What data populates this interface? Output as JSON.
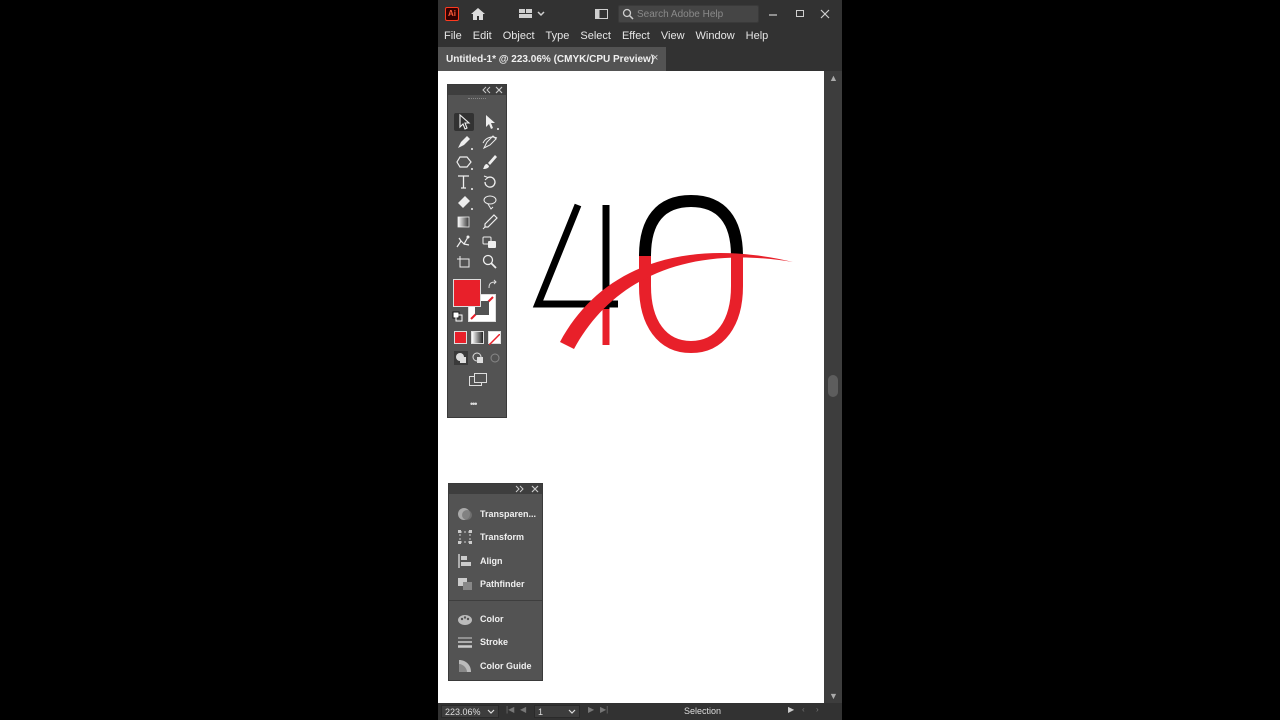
{
  "titlebar": {
    "app_badge": "Ai",
    "search_placeholder": "Search Adobe Help",
    "window_controls": [
      "minimize",
      "maximize",
      "close"
    ]
  },
  "menu": [
    "File",
    "Edit",
    "Object",
    "Type",
    "Select",
    "Effect",
    "View",
    "Window",
    "Help"
  ],
  "document_tab": {
    "label": "Untitled-1* @ 223.06% (CMYK/CPU Preview)",
    "close": "×"
  },
  "artwork": {
    "black_digit": "4",
    "red_digit": "0",
    "colors": {
      "black": "#000000",
      "red": "#e8202a"
    }
  },
  "tools": {
    "rows": [
      [
        "selection-tool",
        "direct-selection-tool"
      ],
      [
        "pen-tool",
        "curvature-tool"
      ],
      [
        "shape-tool",
        "paintbrush-tool"
      ],
      [
        "type-tool",
        "rotate-tool"
      ],
      [
        "eraser-tool",
        "lasso-tool"
      ],
      [
        "gradient-tool",
        "eyedropper-tool"
      ],
      [
        "puppet-warp-tool",
        "symbol-sprayer-tool"
      ],
      [
        "artboard-tool",
        "zoom-tool"
      ]
    ],
    "fill_color": "#e8202a",
    "stroke": "none",
    "more_label": "•••"
  },
  "mini_panel": {
    "group1": [
      "Transparen...",
      "Transform",
      "Align",
      "Pathfinder"
    ],
    "group2": [
      "Color",
      "Stroke",
      "Color Guide"
    ]
  },
  "statusbar": {
    "zoom": "223.06%",
    "artboard": "1",
    "status": "Selection"
  }
}
